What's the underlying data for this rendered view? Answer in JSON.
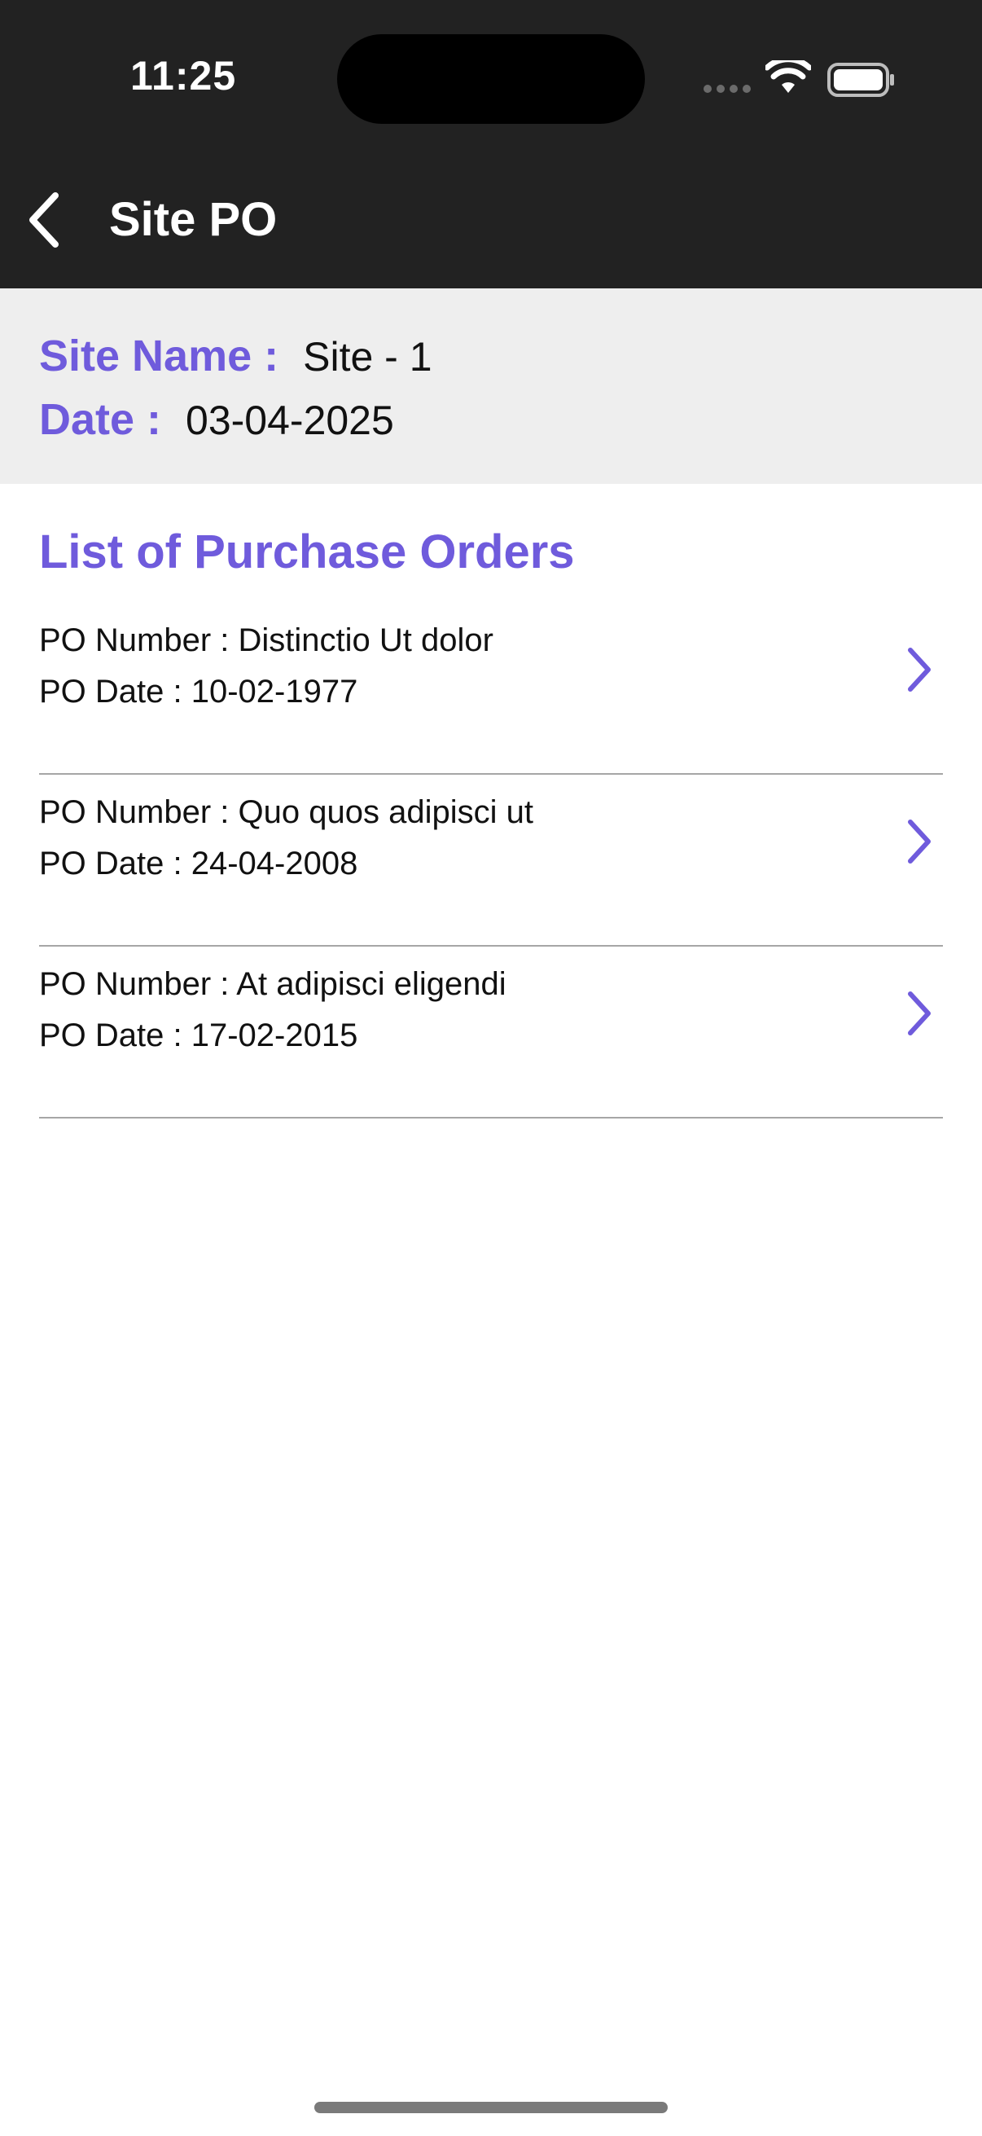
{
  "status_bar": {
    "time": "11:25"
  },
  "nav": {
    "title": "Site PO",
    "back_icon": "chevron-left-icon"
  },
  "site_info": {
    "site_name_label": "Site Name :",
    "site_name_value": "Site - 1",
    "date_label": "Date :",
    "date_value": "03-04-2025"
  },
  "purchase_orders": {
    "title": "List of Purchase Orders",
    "items": [
      {
        "number": "PO Number : Distinctio Ut dolor",
        "date": "PO Date : 10-02-1977"
      },
      {
        "number": "PO Number : Quo quos adipisci ut",
        "date": "PO Date : 24-04-2008"
      },
      {
        "number": "PO Number : At adipisci eligendi",
        "date": "PO Date : 17-02-2015"
      }
    ]
  },
  "colors": {
    "accent": "#6f5bdc",
    "header_bg": "#222222",
    "info_bg": "#eeeeee",
    "divider": "#a6a6a6"
  }
}
